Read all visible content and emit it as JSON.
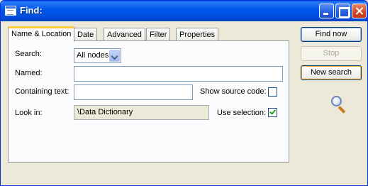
{
  "window": {
    "title": "Find:"
  },
  "tabs": [
    {
      "label": "Name & Location",
      "active": true
    },
    {
      "label": "Date",
      "active": false
    },
    {
      "label": "Advanced",
      "active": false
    },
    {
      "label": "Filter",
      "active": false
    },
    {
      "label": "Properties",
      "active": false
    }
  ],
  "form": {
    "search_label": "Search:",
    "search_value": "All nodes",
    "named_label": "Named:",
    "named_value": "",
    "containing_label": "Containing text:",
    "containing_value": "",
    "show_source_label": "Show source code:",
    "show_source_checked": false,
    "lookin_label": "Look in:",
    "lookin_value": "\\Data Dictionary",
    "use_selection_label": "Use selection:",
    "use_selection_checked": true
  },
  "buttons": {
    "find_now": "Find now",
    "stop": "Stop",
    "new_search": "New search"
  },
  "icons": {
    "window_icon": "window-icon",
    "search_icon": "magnifier-icon"
  }
}
